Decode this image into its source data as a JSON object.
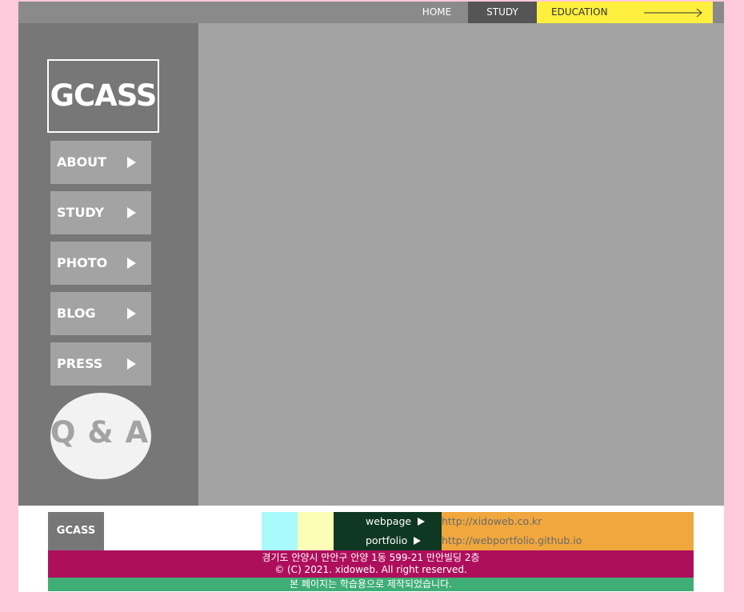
{
  "topnav": {
    "home": "HOME",
    "study": "STUDY",
    "education": "EDUCATION",
    "education_icon": "long-arrow-right-icon"
  },
  "sidebar": {
    "logo": "GCASS",
    "items": [
      {
        "label": "ABOUT",
        "icon": "triangle-right-icon"
      },
      {
        "label": "STUDY",
        "icon": "triangle-right-icon"
      },
      {
        "label": "PHOTO",
        "icon": "triangle-right-icon"
      },
      {
        "label": "BLOG",
        "icon": "triangle-right-icon"
      },
      {
        "label": "PRESS",
        "icon": "triangle-right-icon"
      }
    ],
    "qa": "Q & A"
  },
  "footer": {
    "logo": "GCASS",
    "links": [
      {
        "label": "webpage",
        "url": "http://xidoweb.co.kr"
      },
      {
        "label": "portfolio",
        "url": "http://webportfolio.github.io"
      }
    ],
    "address": "경기도 안양시 만안구 안양 1동 599-21 만안빌딩 2층",
    "copyright": "© (C) 2021. xidoweb. All right reserved.",
    "notice": "본 페이지는 학습용으로 제작되었습니다."
  },
  "colors": {
    "background": "#ffc9dc",
    "topbar": "#8a8a8a",
    "sidebar": "#777777",
    "content": "#a3a3a3",
    "education_tab": "#ffef3e",
    "address_bar": "#ae0f5c",
    "notice_bar": "#3fad76",
    "url_block": "#f0a73d",
    "links_block": "#0f3823"
  }
}
